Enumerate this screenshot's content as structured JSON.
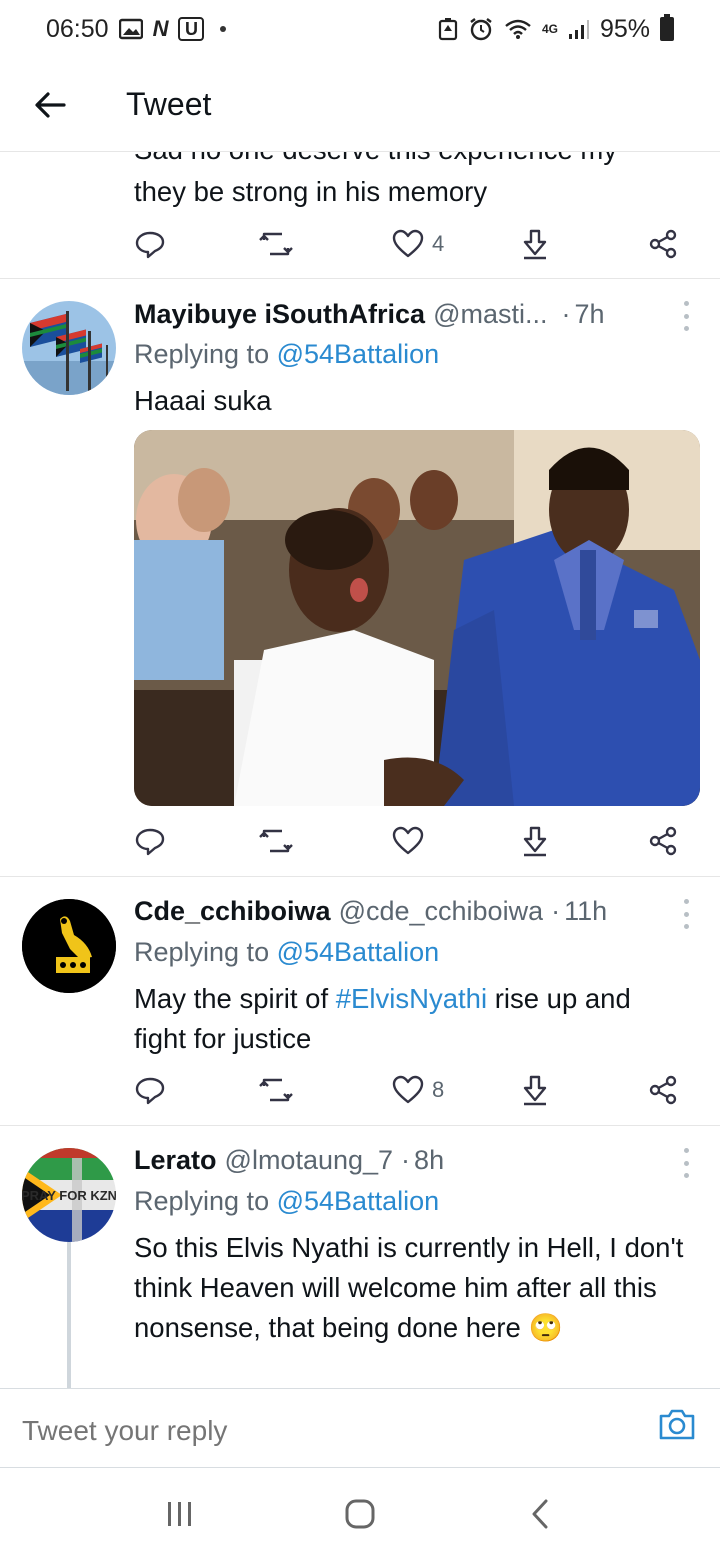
{
  "status_bar": {
    "time": "06:50",
    "battery": "95%",
    "network": "4G",
    "letters_n": "N",
    "letters_u": "U"
  },
  "header": {
    "title": "Tweet"
  },
  "tweets": [
    {
      "partial_text_1": "Sad no one deserve this experience my",
      "partial_text_2": "they be strong in his memory",
      "like_count": "4"
    },
    {
      "name": "Mayibuye iSouthAfrica",
      "handle": "@masti...",
      "sep": "·",
      "time": "7h",
      "replying_prefix": "Replying to",
      "replying_to": "@54Battalion",
      "text": "Haaai suka",
      "like_count": ""
    },
    {
      "name": "Cde_cchiboiwa",
      "handle": "@cde_cchiboiwa",
      "sep": "·",
      "time": "11h",
      "replying_prefix": "Replying to",
      "replying_to": "@54Battalion",
      "text_pre": "May the spirit of ",
      "hashtag": "#ElvisNyathi",
      "text_post": " rise up and fight for justice",
      "like_count": "8"
    },
    {
      "name": "Lerato",
      "handle": "@lmotaung_7",
      "sep": "·",
      "time": "8h",
      "replying_prefix": "Replying to",
      "replying_to": "@54Battalion",
      "text": "So this Elvis Nyathi is currently in Hell, I don't think Heaven will welcome him after all this nonsense, that being done here",
      "emoji": "🙄",
      "avatar_text": "PRAY FOR KZN"
    }
  ],
  "composer": {
    "placeholder": "Tweet your reply"
  },
  "icons": {
    "back": "arrow-left-icon",
    "reply": "reply-icon",
    "retweet": "retweet-icon",
    "like": "heart-icon",
    "download": "download-icon",
    "share": "share-icon",
    "camera": "camera-icon"
  },
  "colors": {
    "link": "#2a8ad0",
    "secondary": "#5b6670",
    "divider": "#e6e6e6"
  }
}
